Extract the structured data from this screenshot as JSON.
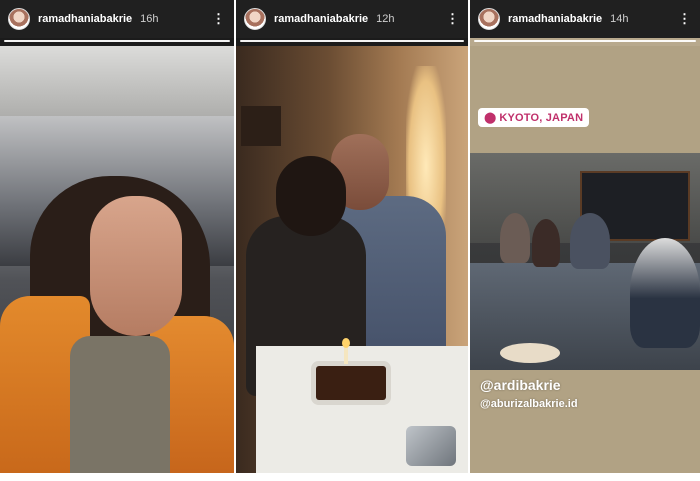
{
  "stories": [
    {
      "username": "ramadhaniabakrie",
      "time": "16h",
      "more_icon": "more-icon",
      "segments_done": 1,
      "segments_total": 1
    },
    {
      "username": "ramadhaniabakrie",
      "time": "12h",
      "more_icon": "more-icon",
      "segments_done": 1,
      "segments_total": 1
    },
    {
      "username": "ramadhaniabakrie",
      "time": "14h",
      "more_icon": "more-icon",
      "segments_done": 1,
      "segments_total": 1,
      "location": "KYOTO, JAPAN",
      "mentions": [
        "@ardibakrie",
        "@aburizalbakrie.id"
      ]
    }
  ],
  "colors": {
    "header_bg": "#202020",
    "location_text": "#c0306b",
    "story3_bg": "#b1a284"
  }
}
